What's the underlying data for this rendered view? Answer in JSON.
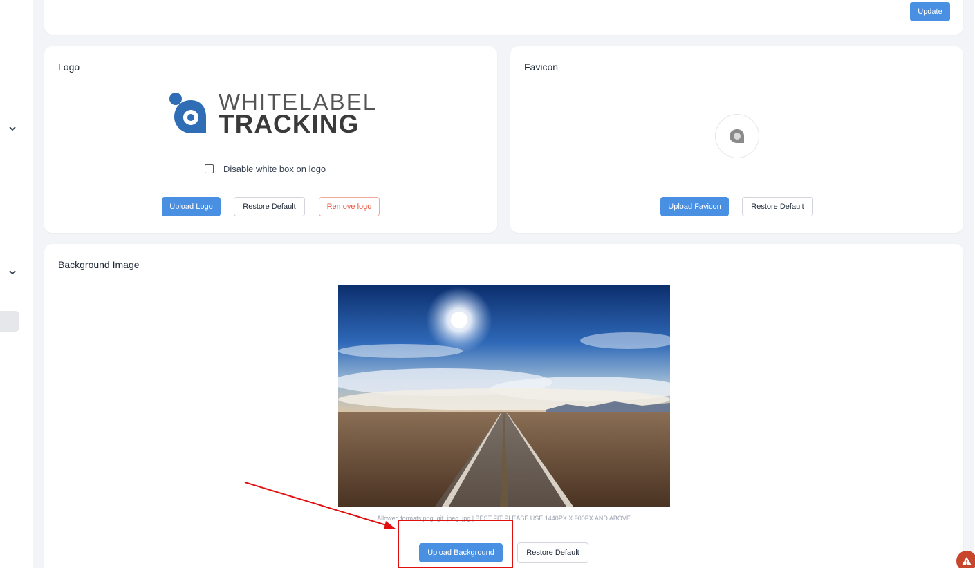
{
  "top": {
    "update_label": "Update"
  },
  "logo": {
    "title": "Logo",
    "brand_line1": "WHITELABEL",
    "brand_line2": "TRACKING",
    "disable_white_box_label": "Disable white box on logo",
    "disable_white_box_checked": false,
    "upload_label": "Upload Logo",
    "restore_label": "Restore Default",
    "remove_label": "Remove logo"
  },
  "favicon": {
    "title": "Favicon",
    "upload_label": "Upload Favicon",
    "restore_label": "Restore Default"
  },
  "background": {
    "title": "Background Image",
    "hint": "Allowed formats png, gif, jpeg, jpg | BEST FIT PLEASE USE 1440PX X 900PX AND ABOVE",
    "upload_label": "Upload Background",
    "restore_label": "Restore Default"
  },
  "colors": {
    "primary": "#4a90e2",
    "danger": "#e8553e",
    "annotation": "#e01010",
    "brand_blue": "#2f6db5"
  },
  "icons": {
    "sidebar_chevrons": [
      "chevron-down-icon",
      "chevron-down-icon"
    ],
    "warning": "warning-icon"
  }
}
